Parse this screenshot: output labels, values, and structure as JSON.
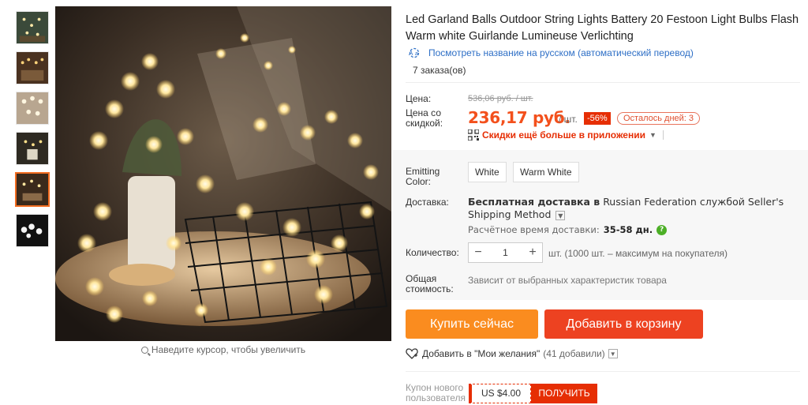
{
  "product": {
    "title": "Led Garland Balls Outdoor String Lights Battery 20 Festoon Light Bulbs Flash Warm white Guirlande Lumineuse Verlichting",
    "translate_link": "Посмотреть название на русском (автоматический перевод)",
    "orders": "7 заказа(ов)"
  },
  "gallery": {
    "thumbnails": [
      "thumb-1",
      "thumb-2",
      "thumb-3",
      "thumb-4",
      "thumb-5",
      "thumb-6"
    ],
    "active_index": 4,
    "zoom_hint": "Наведите курсор, чтобы увеличить"
  },
  "price": {
    "label": "Цена:",
    "old": "536,06 руб. / шт.",
    "discount_label": "Цена со скидкой:",
    "new": "236,17 руб.",
    "per_unit": "/ шт.",
    "discount_badge": "-56%",
    "days_left": "Осталось дней: 3",
    "app_promo": "Скидки ещё больше в приложении"
  },
  "options": {
    "color_label": "Emitting Color:",
    "colors": [
      "White",
      "Warm White"
    ]
  },
  "shipping": {
    "label": "Доставка:",
    "free_prefix": "Бесплатная доставка в",
    "country": "Russian Federation",
    "via": "службой",
    "method": "Seller's Shipping Method",
    "estimate_label": "Расчётное время доставки:",
    "estimate_value": "35-58 дн.",
    "help": "?"
  },
  "quantity": {
    "label": "Количество:",
    "value": "1",
    "minus": "−",
    "plus": "+",
    "info": "шт. (1000 шт. – максимум на покупателя)"
  },
  "total": {
    "label": "Общая стоимость:",
    "value": "Зависит от выбранных характеристик товара"
  },
  "actions": {
    "buy_now": "Купить сейчас",
    "add_to_cart": "Добавить в корзину",
    "wishlist": "Добавить в \"Мои желания\"",
    "wishlist_count": "(41 добавили)"
  },
  "coupon": {
    "label": "Купон нового пользователя",
    "amount": "US $4.00",
    "get": "ПОЛУЧИТЬ"
  },
  "colors": {
    "accent_orange": "#fa8c1f",
    "accent_red": "#ed4221",
    "price_red": "#f3501c",
    "link_blue": "#2e6fc6"
  }
}
